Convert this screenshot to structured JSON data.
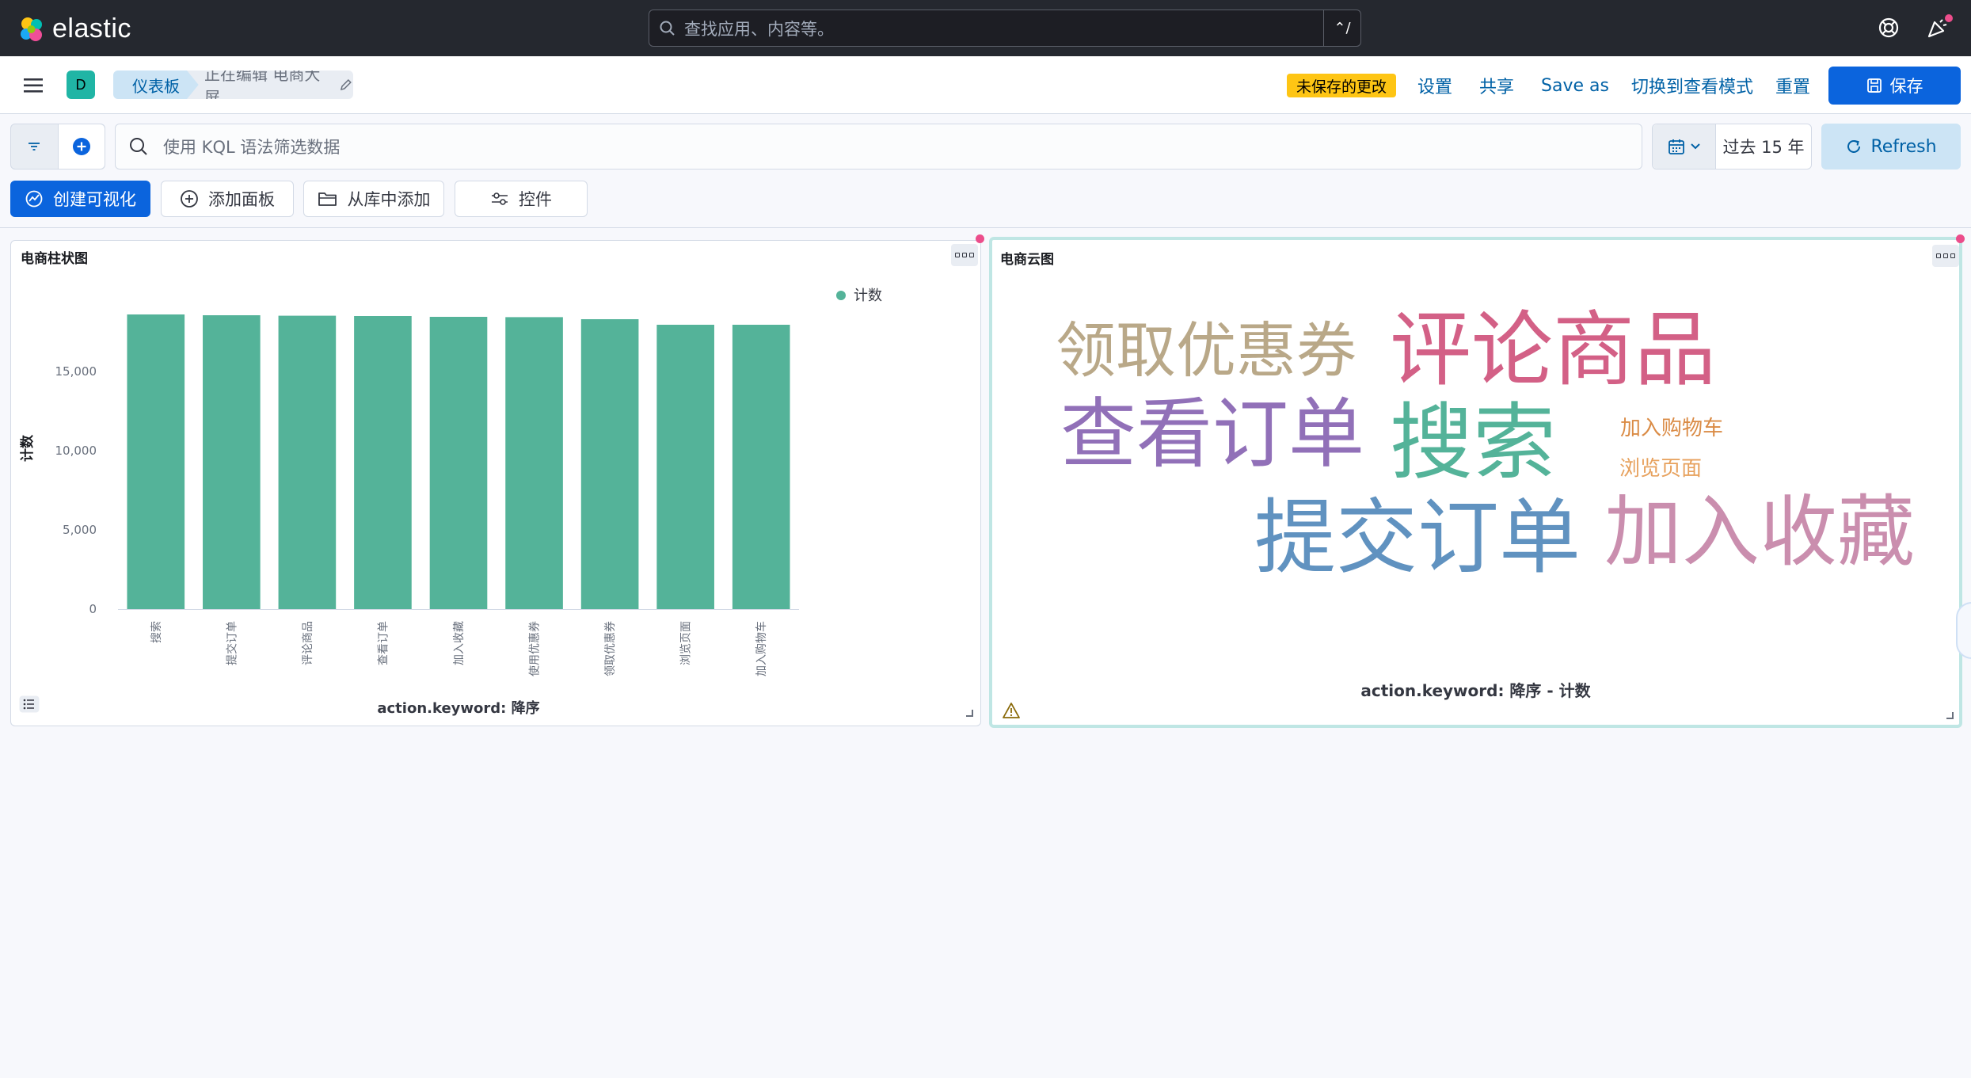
{
  "header": {
    "brand": "elastic",
    "search_placeholder": "查找应用、内容等。",
    "search_shortcut": "⌃/"
  },
  "breadcrumbs": {
    "space_initial": "D",
    "items": [
      "仪表板",
      "正在编辑 电商大屏"
    ]
  },
  "topnav": {
    "unsaved_badge": "未保存的更改",
    "settings": "设置",
    "share": "共享",
    "save_as": "Save as",
    "switch_view": "切换到查看模式",
    "reset": "重置",
    "save": "保存"
  },
  "querybar": {
    "placeholder": "使用 KQL 语法筛选数据",
    "time_range": "过去 15 年",
    "refresh": "Refresh"
  },
  "actions": {
    "create_viz": "创建可视化",
    "add_panel": "添加面板",
    "add_from_library": "从库中添加",
    "controls": "控件"
  },
  "panels": {
    "bar_title": "电商柱状图",
    "cloud_title": "电商云图",
    "cloud_caption": "action.keyword: 降序 - 计数"
  },
  "chart_data": {
    "type": "bar",
    "title": "电商柱状图",
    "xlabel": "action.keyword: 降序",
    "ylabel": "计数",
    "legend": [
      "计数"
    ],
    "legend_position": "top-right",
    "categories": [
      "搜索",
      "提交订单",
      "评论商品",
      "查看订单",
      "加入收藏",
      "使用优惠券",
      "领取优惠券",
      "浏览页面",
      "加入购物车"
    ],
    "values": [
      18600,
      18550,
      18520,
      18500,
      18450,
      18430,
      18300,
      17950,
      17950
    ],
    "yticks": [
      "0",
      "5,000",
      "10,000",
      "15,000"
    ],
    "ylim": [
      0,
      20000
    ],
    "color": "#54b399"
  },
  "cloud_data": {
    "words": [
      {
        "text": "领取优惠券",
        "color": "#b9a888"
      },
      {
        "text": "评论商品",
        "color": "#d36086"
      },
      {
        "text": "查看订单",
        "color": "#9170b8"
      },
      {
        "text": "搜索",
        "color": "#54b399"
      },
      {
        "text": "加入购物车",
        "color": "#da8b45"
      },
      {
        "text": "浏览页面",
        "color": "#e7a15d"
      },
      {
        "text": "提交订单",
        "color": "#6092c0"
      },
      {
        "text": "加入收藏",
        "color": "#ca8eae"
      }
    ]
  },
  "colors": {
    "header_bg": "#25282f",
    "primary": "#0b64dd",
    "link": "#0061a6",
    "warning": "#fec514",
    "bar": "#54b399"
  }
}
